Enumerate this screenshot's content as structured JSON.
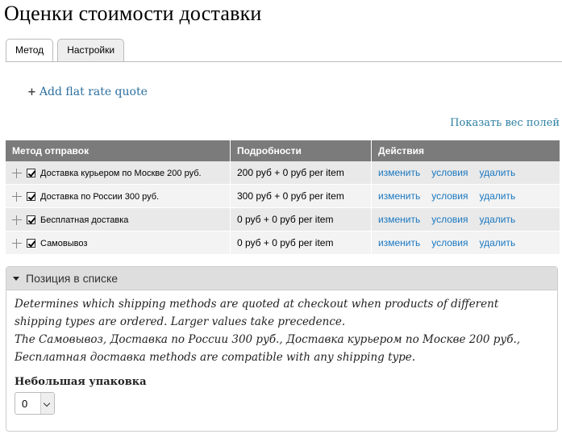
{
  "page": {
    "title": "Оценки стоимости доставки"
  },
  "tabs": [
    {
      "label": "Метод"
    },
    {
      "label": "Настройки"
    }
  ],
  "actions": {
    "add_flat_rate": "Add flat rate quote",
    "show_weights": "Показать вес полей"
  },
  "table": {
    "headers": {
      "method": "Метод отправок",
      "details": "Подробности",
      "actions": "Действия"
    },
    "rows": [
      {
        "name": "Доставка курьером по Москве 200 руб.",
        "details": "200 руб + 0 руб per item",
        "checked": true
      },
      {
        "name": "Доставка по России 300 руб.",
        "details": "300 руб + 0 руб per item",
        "checked": true
      },
      {
        "name": "Бесплатная доставка",
        "details": "0 руб + 0 руб per item",
        "checked": true
      },
      {
        "name": "Самовывоз",
        "details": "0 руб + 0 руб per item",
        "checked": true
      }
    ],
    "row_actions": {
      "edit": "изменить",
      "conditions": "условия",
      "delete": "удалить"
    }
  },
  "fieldset": {
    "legend": "Позиция в списке",
    "desc1": "Determines which shipping methods are quoted at checkout when products of different shipping types are ordered. Larger values take precedence.",
    "desc2": "The Самовывоз, Доставка по России 300 руб., Доставка курьером по Москве 200 руб., Бесплатная доставка methods are compatible with any shipping type.",
    "package_label": "Небольшая упаковка",
    "package_value": "0"
  },
  "colors": {
    "link": "#1a78c0",
    "header_bg": "#7b7b7b"
  }
}
